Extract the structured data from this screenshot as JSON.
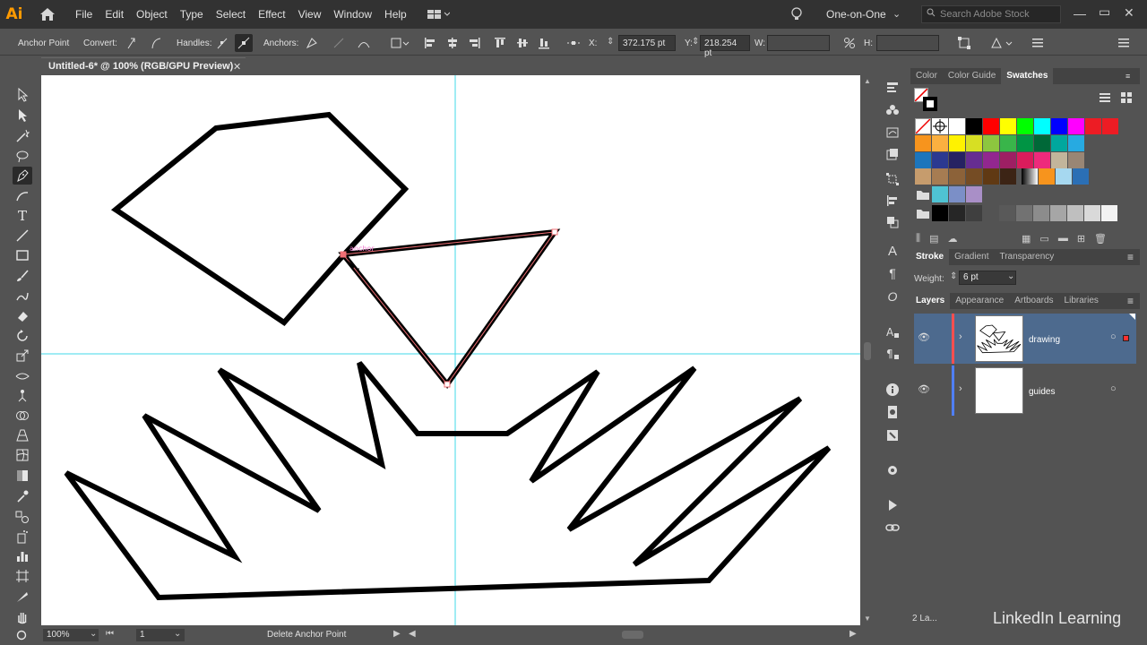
{
  "app": {
    "logo": "Ai"
  },
  "menu": {
    "items": [
      "File",
      "Edit",
      "Object",
      "Type",
      "Select",
      "Effect",
      "View",
      "Window",
      "Help"
    ]
  },
  "workspace": {
    "label": "One-on-One"
  },
  "search": {
    "placeholder": "Search Adobe Stock"
  },
  "control_bar": {
    "anchor_point": "Anchor Point",
    "convert": "Convert:",
    "handles": "Handles:",
    "anchors": "Anchors:",
    "x_label": "X:",
    "x_value": "372.175 pt",
    "y_label": "Y:",
    "y_value": "218.254 pt",
    "w_label": "W:",
    "h_label": "H:"
  },
  "document": {
    "tab_title": "Untitled-6* @ 100% (RGB/GPU Preview)",
    "close": "✕"
  },
  "swatches_panel": {
    "tabs": [
      "Color",
      "Color Guide",
      "Swatches"
    ],
    "active_tab": "Swatches",
    "row1": [
      "#ffffff",
      "#000000",
      "#ff0000",
      "#ffff00",
      "#00ff00",
      "#00ffff",
      "#0000ff",
      "#ff00ff",
      "#ed1c24",
      "#ed1c24"
    ],
    "row2": [
      "#f7941d",
      "#fbb040",
      "#fff200",
      "#d7df23",
      "#8dc63f",
      "#39b54a",
      "#009444",
      "#006838",
      "#00a79d",
      "#27aae1"
    ],
    "row3": [
      "#1c75bc",
      "#2b3990",
      "#262262",
      "#662d91",
      "#92278f",
      "#9e1f63",
      "#da1c5c",
      "#ee2a7b",
      "#c2b59b",
      "#998675"
    ],
    "row4": [
      "#c69c6d",
      "#a67c52",
      "#8c6239",
      "#754c24",
      "#603913",
      "#3c2415"
    ],
    "row5": [
      "#4fc3d3",
      "#7b8fc7",
      "#a98fc7"
    ],
    "grays": [
      "#000000",
      "#262626",
      "#3f3f3f",
      "#595959",
      "#727272",
      "#8c8c8c",
      "#a6a6a6",
      "#bfbfbf",
      "#d9d9d9",
      "#f2f2f2"
    ]
  },
  "stroke_panel": {
    "tabs": [
      "Stroke",
      "Gradient",
      "Transparency"
    ],
    "weight_label": "Weight:",
    "weight_value": "6 pt"
  },
  "layers_panel": {
    "tabs": [
      "Layers",
      "Appearance",
      "Artboards",
      "Libraries"
    ],
    "layers": [
      {
        "name": "drawing",
        "color": "#ff4f4f"
      },
      {
        "name": "guides",
        "color": "#4f7fff"
      }
    ],
    "count": "2 La..."
  },
  "status_bar": {
    "zoom": "100%",
    "artboard": "1",
    "tool": "Delete Anchor Point"
  },
  "watermark": "LinkedIn Learning"
}
